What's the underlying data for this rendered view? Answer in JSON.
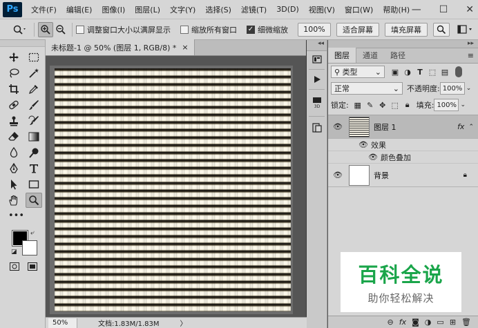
{
  "app": {
    "logo": "Ps"
  },
  "menu": [
    "文件(F)",
    "编辑(E)",
    "图像(I)",
    "图层(L)",
    "文字(Y)",
    "选择(S)",
    "滤镜(T)",
    "3D(D)",
    "视图(V)",
    "窗口(W)",
    "帮助(H)"
  ],
  "window_controls": {
    "minimize": "—",
    "maximize": "☐",
    "close": "✕"
  },
  "options": {
    "resize_windows": "调整窗口大小以满屏显示",
    "zoom_all": "缩放所有窗口",
    "scrubby_zoom": "细微缩放",
    "zoom_percent": "100%",
    "fit_screen": "适合屏幕",
    "fill_screen": "填充屏幕",
    "resize_windows_checked": false,
    "zoom_all_checked": false,
    "scrubby_zoom_checked": true
  },
  "document": {
    "tab_title": "未标题-1 @ 50% (图层 1, RGB/8) *",
    "tab_close": "×",
    "zoom": "50%",
    "doc_info": "文档:1.83M/1.83M",
    "status_arrow": "〉"
  },
  "layers_panel": {
    "tabs": [
      "图层",
      "通道",
      "路径"
    ],
    "filter_kind": "类型",
    "blend_mode": "正常",
    "opacity_label": "不透明度:",
    "opacity_value": "100%",
    "lock_label": "锁定:",
    "fill_label": "填充:",
    "fill_value": "100%",
    "layers": [
      {
        "name": "图层 1",
        "fx": "fx",
        "selected": true
      },
      {
        "name": "背景",
        "locked": true
      }
    ],
    "effects_label": "效果",
    "effect_name": "颜色叠加"
  },
  "watermark": {
    "title": "百科全说",
    "subtitle": "助你轻松解决"
  }
}
